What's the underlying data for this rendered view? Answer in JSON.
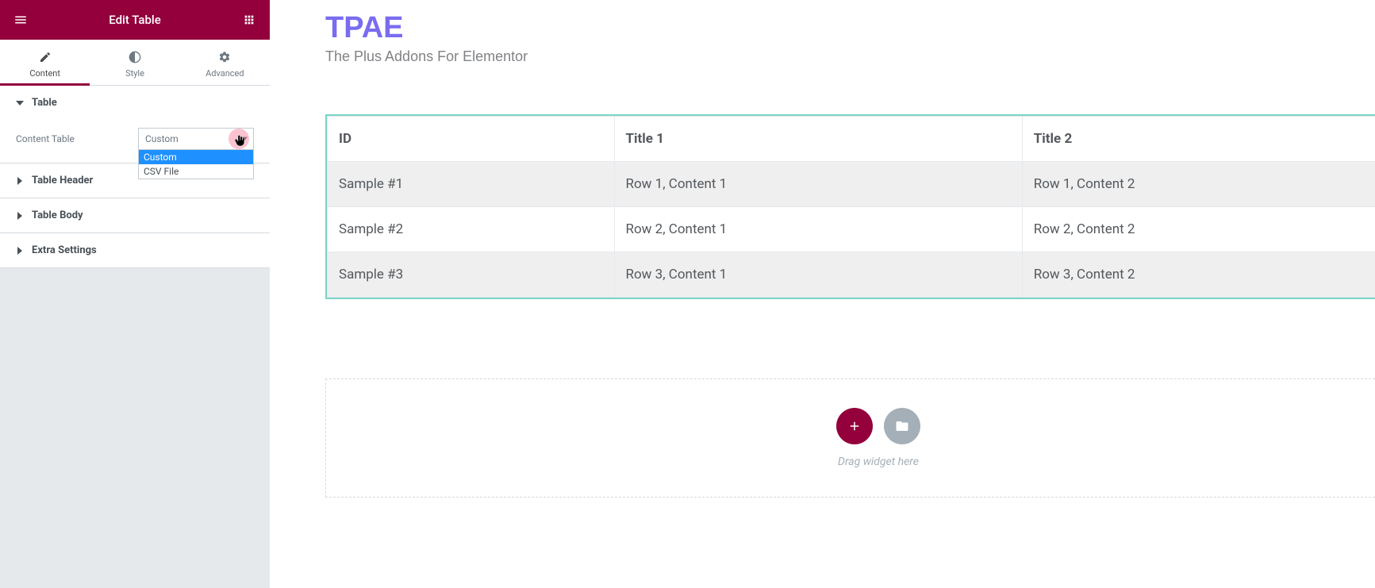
{
  "sidebar": {
    "title": "Edit Table",
    "tabs": {
      "content": "Content",
      "style": "Style",
      "advanced": "Advanced"
    },
    "sections": {
      "table": {
        "title": "Table",
        "contentTableLabel": "Content Table",
        "selectedValue": "Custom",
        "options": [
          "Custom",
          "CSV File"
        ]
      },
      "header": {
        "title": "Table Header"
      },
      "body": {
        "title": "Table Body"
      },
      "extra": {
        "title": "Extra Settings"
      }
    }
  },
  "canvas": {
    "brandTitle": "TPAE",
    "brandSubtitle": "The Plus Addons For Elementor",
    "table": {
      "headers": [
        "ID",
        "Title 1",
        "Title 2"
      ],
      "rows": [
        [
          "Sample #1",
          "Row 1, Content 1",
          "Row 1, Content 2"
        ],
        [
          "Sample #2",
          "Row 2, Content 1",
          "Row 2, Content 2"
        ],
        [
          "Sample #3",
          "Row 3, Content 1",
          "Row 3, Content 2"
        ]
      ]
    },
    "dropzone": {
      "text": "Drag widget here"
    }
  }
}
